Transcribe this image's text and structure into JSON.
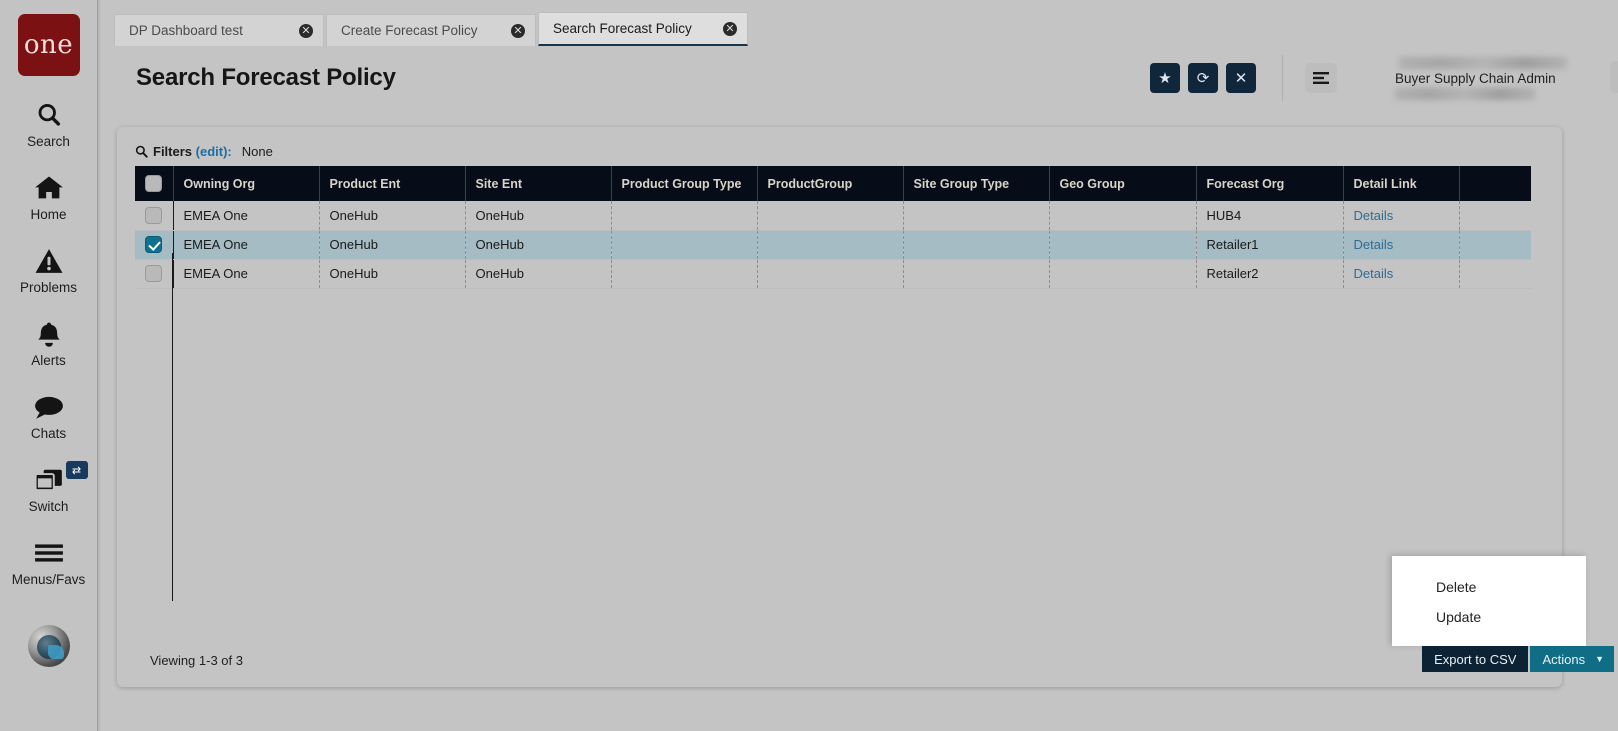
{
  "rail": {
    "logo_text": "one",
    "items": [
      {
        "label": "Search",
        "icon": "search-icon"
      },
      {
        "label": "Home",
        "icon": "home-icon"
      },
      {
        "label": "Problems",
        "icon": "warning-triangle-icon"
      },
      {
        "label": "Alerts",
        "icon": "bell-icon"
      },
      {
        "label": "Chats",
        "icon": "chat-bubble-icon"
      },
      {
        "label": "Switch",
        "icon": "windows-stack-icon",
        "badge": "⇄"
      },
      {
        "label": "Menus/Favs",
        "icon": "hamburger-icon"
      }
    ],
    "avatar": "user-avatar"
  },
  "tabs": [
    {
      "title": "DP Dashboard test",
      "active": false,
      "close": "✕"
    },
    {
      "title": "Create Forecast Policy",
      "active": false,
      "close": "✕"
    },
    {
      "title": "Search Forecast Policy",
      "active": true,
      "close": "✕"
    }
  ],
  "header": {
    "title": "Search Forecast Policy",
    "buttons": [
      {
        "name": "favorite-button",
        "glyph": "★"
      },
      {
        "name": "refresh-button",
        "glyph": "⟳"
      },
      {
        "name": "close-button",
        "glyph": "✕"
      }
    ],
    "menu_button_glyph": "☰",
    "user": {
      "role": "Buyer Supply Chain Admin",
      "name_redacted": true,
      "org_redacted": true
    },
    "chevron_glyph": "⌄"
  },
  "filters": {
    "icon": "search-icon",
    "label": "Filters",
    "edit_label": "(edit):",
    "value": "None"
  },
  "table": {
    "columns": [
      "",
      "Owning Org",
      "Product Ent",
      "Site Ent",
      "Product Group Type",
      "ProductGroup",
      "Site Group Type",
      "Geo Group",
      "Forecast Org",
      "Detail Link",
      ""
    ],
    "rows": [
      {
        "selected": false,
        "owning_org": "EMEA One",
        "product_ent": "OneHub",
        "site_ent": "OneHub",
        "product_group_type": "",
        "product_group": "",
        "site_group_type": "",
        "geo_group": "",
        "forecast_org": "HUB4",
        "detail_link": "Details"
      },
      {
        "selected": true,
        "owning_org": "EMEA One",
        "product_ent": "OneHub",
        "site_ent": "OneHub",
        "product_group_type": "",
        "product_group": "",
        "site_group_type": "",
        "geo_group": "",
        "forecast_org": "Retailer1",
        "detail_link": "Details"
      },
      {
        "selected": false,
        "owning_org": "EMEA One",
        "product_ent": "OneHub",
        "site_ent": "OneHub",
        "product_group_type": "",
        "product_group": "",
        "site_group_type": "",
        "geo_group": "",
        "forecast_org": "Retailer2",
        "detail_link": "Details"
      }
    ]
  },
  "footer": {
    "viewing": "Viewing 1-3 of 3",
    "export_label": "Export to CSV",
    "actions_label": "Actions",
    "actions_caret": "▼"
  },
  "actions_menu": {
    "open": true,
    "items": [
      "Delete",
      "Update"
    ]
  },
  "colors": {
    "brand_red": "#7b1113",
    "header_dark": "#070d18",
    "row_selected": "#a5bcc4",
    "teal": "#0f6d86",
    "link": "#2f6d93",
    "page_bg": "#c4c4c4"
  }
}
